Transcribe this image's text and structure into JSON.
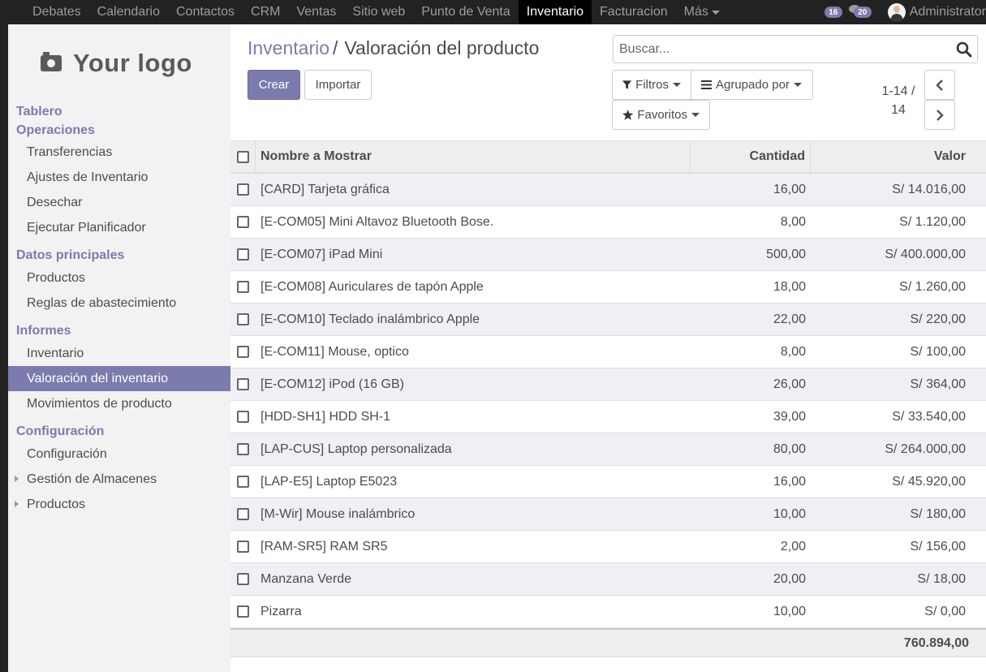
{
  "navbar": {
    "apps": [
      "Debates",
      "Calendario",
      "Contactos",
      "CRM",
      "Ventas",
      "Sitio web",
      "Punto de Venta",
      "Inventario",
      "Facturacion"
    ],
    "active_app": "Inventario",
    "more_label": "Más",
    "activity_count": "16",
    "messages_count": "20",
    "user_name": "Administrator"
  },
  "sidebar": {
    "logo_text": "Your logo",
    "sections": [
      {
        "label": "Tablero",
        "items": []
      },
      {
        "label": "Operaciones",
        "items": [
          "Transferencias",
          "Ajustes de Inventario",
          "Desechar",
          "Ejecutar Planificador"
        ]
      },
      {
        "label": "Datos principales",
        "items": [
          "Productos",
          "Reglas de abastecimiento"
        ]
      },
      {
        "label": "Informes",
        "items": [
          "Inventario",
          "Valoración del inventario",
          "Movimientos de producto"
        ]
      },
      {
        "label": "Configuración",
        "items": [
          "Configuración",
          "Gestión de Almacenes",
          "Productos"
        ]
      }
    ],
    "active_item": "Valoración del inventario"
  },
  "breadcrumb": {
    "parent": "Inventario",
    "current": "Valoración del producto"
  },
  "buttons": {
    "create": "Crear",
    "import": "Importar",
    "filters": "Filtros",
    "group_by": "Agrupado por",
    "favorites": "Favoritos"
  },
  "search": {
    "placeholder": "Buscar..."
  },
  "pager": {
    "range": "1-14 /",
    "total": "14"
  },
  "table": {
    "headers": {
      "name": "Nombre a Mostrar",
      "qty": "Cantidad",
      "value": "Valor"
    },
    "rows": [
      {
        "name": "[CARD] Tarjeta gráfica",
        "qty": "16,00",
        "value": "S/ 14.016,00"
      },
      {
        "name": "[E-COM05] Mini Altavoz Bluetooth Bose.",
        "qty": "8,00",
        "value": "S/ 1.120,00"
      },
      {
        "name": "[E-COM07] iPad Mini",
        "qty": "500,00",
        "value": "S/ 400.000,00"
      },
      {
        "name": "[E-COM08] Auriculares de tapón Apple",
        "qty": "18,00",
        "value": "S/ 1.260,00"
      },
      {
        "name": "[E-COM10] Teclado inalámbrico Apple",
        "qty": "22,00",
        "value": "S/ 220,00"
      },
      {
        "name": "[E-COM11] Mouse, optico",
        "qty": "8,00",
        "value": "S/ 100,00"
      },
      {
        "name": "[E-COM12] iPod (16 GB)",
        "qty": "26,00",
        "value": "S/ 364,00"
      },
      {
        "name": "[HDD-SH1] HDD SH-1",
        "qty": "39,00",
        "value": "S/ 33.540,00"
      },
      {
        "name": "[LAP-CUS] Laptop personalizada",
        "qty": "80,00",
        "value": "S/ 264.000,00"
      },
      {
        "name": "[LAP-E5] Laptop E5023",
        "qty": "16,00",
        "value": "S/ 45.920,00"
      },
      {
        "name": "[M-Wir] Mouse inalámbrico",
        "qty": "10,00",
        "value": "S/ 180,00"
      },
      {
        "name": "[RAM-SR5] RAM SR5",
        "qty": "2,00",
        "value": "S/ 156,00"
      },
      {
        "name": "Manzana Verde",
        "qty": "20,00",
        "value": "S/ 18,00"
      },
      {
        "name": "Pizarra",
        "qty": "10,00",
        "value": "S/ 0,00"
      }
    ],
    "total": "760.894,00"
  },
  "colors": {
    "brand": "#7c7bad",
    "navbar": "#222222",
    "row_alt": "#eff0f6"
  }
}
